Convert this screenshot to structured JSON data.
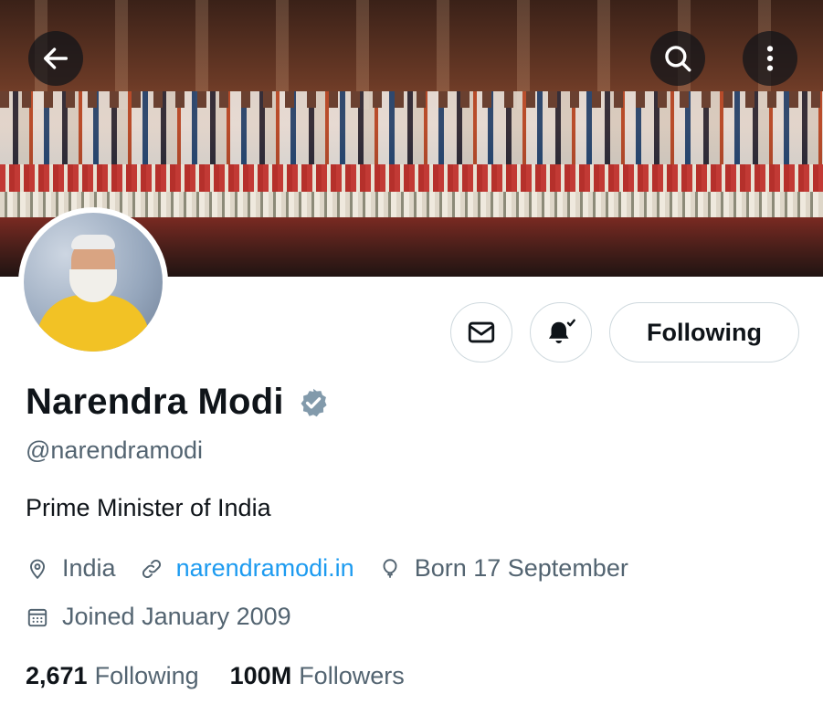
{
  "header": {
    "back_icon": "arrow-left-icon",
    "search_icon": "search-icon",
    "more_icon": "more-vertical-icon"
  },
  "actions": {
    "message_icon": "mail-icon",
    "notify_icon": "bell-check-icon",
    "following_label": "Following"
  },
  "profile": {
    "name": "Narendra Modi",
    "handle": "@narendramodi",
    "bio": "Prime Minister of India",
    "location": "India",
    "website": "narendramodi.in",
    "birthday": "Born 17 September",
    "joined": "Joined January 2009",
    "verified_color": "#829aab"
  },
  "stats": {
    "following_count": "2,671",
    "following_label": "Following",
    "followers_count": "100M",
    "followers_label": "Followers"
  },
  "colors": {
    "link": "#1d9bf0",
    "secondary_text": "#536471",
    "primary_text": "#0f1419"
  }
}
